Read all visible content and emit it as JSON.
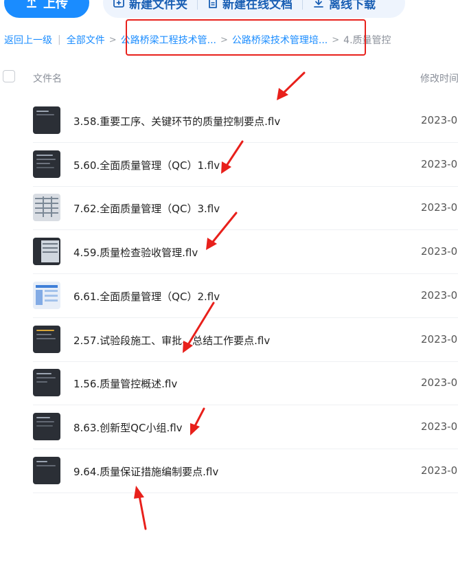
{
  "toolbar": {
    "upload_label": "上传",
    "new_folder_label": "新建文件夹",
    "new_doc_label": "新建在线文档",
    "offline_download_label": "离线下载"
  },
  "breadcrumb": {
    "back": "返回上一级",
    "all_files": "全部文件",
    "level1": "公路桥梁工程技术管...",
    "level2": "公路桥梁技术管理培...",
    "current": "4.质量管控"
  },
  "table": {
    "col_name": "文件名",
    "col_modified": "修改时间"
  },
  "files": [
    {
      "name": "3.58.重要工序、关键环节的质量控制要点.flv",
      "date": "2023-0"
    },
    {
      "name": "5.60.全面质量管理（QC）1.flv",
      "date": "2023-0"
    },
    {
      "name": "7.62.全面质量管理（QC）3.flv",
      "date": "2023-0"
    },
    {
      "name": "4.59.质量检查验收管理.flv",
      "date": "2023-0"
    },
    {
      "name": "6.61.全面质量管理（QC）2.flv",
      "date": "2023-0"
    },
    {
      "name": "2.57.试验段施工、审批、总结工作要点.flv",
      "date": "2023-0"
    },
    {
      "name": "1.56.质量管控概述.flv",
      "date": "2023-0"
    },
    {
      "name": "8.63.创新型QC小组.flv",
      "date": "2023-0"
    },
    {
      "name": "9.64.质量保证措施编制要点.flv",
      "date": "2023-0"
    }
  ],
  "colors": {
    "accent": "#1a8cff",
    "annotation": "#e8201b"
  }
}
